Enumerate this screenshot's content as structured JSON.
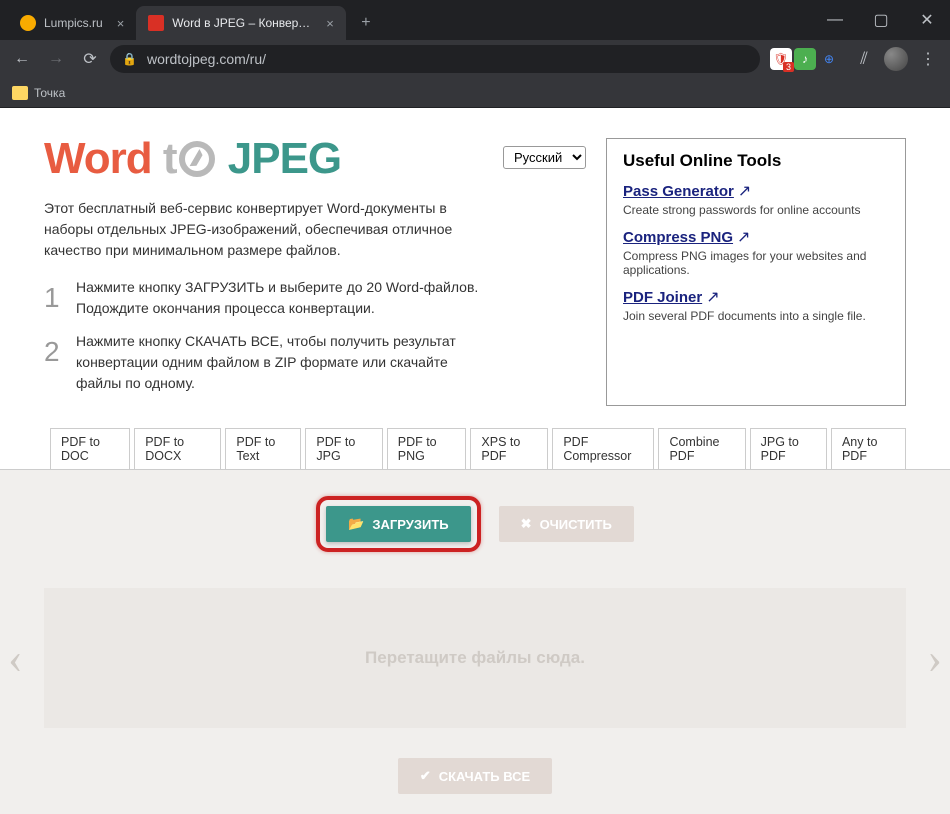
{
  "browser": {
    "tabs": [
      {
        "title": "Lumpics.ru",
        "favColor": "#f9ab00",
        "active": false
      },
      {
        "title": "Word в JPEG – Конвертировать",
        "favColor": "#d93025",
        "active": true
      }
    ],
    "url": "wordtojpeg.com/ru/",
    "bookmark": "Точка"
  },
  "logo": {
    "p1": "Word",
    "p2": "t",
    "p3": "JPEG"
  },
  "intro": "Этот бесплатный веб-сервис конвертирует Word-документы в наборы отдельных JPEG-изображений, обеспечивая отличное качество при минимальном размере файлов.",
  "steps": [
    "Нажмите кнопку ЗАГРУЗИТЬ и выберите до 20 Word-файлов. Подождите окончания процесса конвертации.",
    "Нажмите кнопку СКАЧАТЬ ВСЕ, чтобы получить результат конвертации одним файлом в ZIP формате или скачайте файлы по одному."
  ],
  "lang": "Русский",
  "sidebar": {
    "title": "Useful Online Tools",
    "items": [
      {
        "title": "Pass Generator",
        "desc": "Create strong passwords for online accounts"
      },
      {
        "title": "Compress PNG",
        "desc": "Compress PNG images for your websites and applications."
      },
      {
        "title": "PDF Joiner",
        "desc": "Join several PDF documents into a single file."
      }
    ]
  },
  "convTabs": [
    "PDF to DOC",
    "PDF to DOCX",
    "PDF to Text",
    "PDF to JPG",
    "PDF to PNG",
    "XPS to PDF",
    "PDF Compressor",
    "Combine PDF",
    "JPG to PDF",
    "Any to PDF"
  ],
  "buttons": {
    "upload": "ЗАГРУЗИТЬ",
    "clear": "ОЧИСТИТЬ",
    "download": "СКАЧАТЬ ВСЕ"
  },
  "dropHint": "Перетащите файлы сюда."
}
